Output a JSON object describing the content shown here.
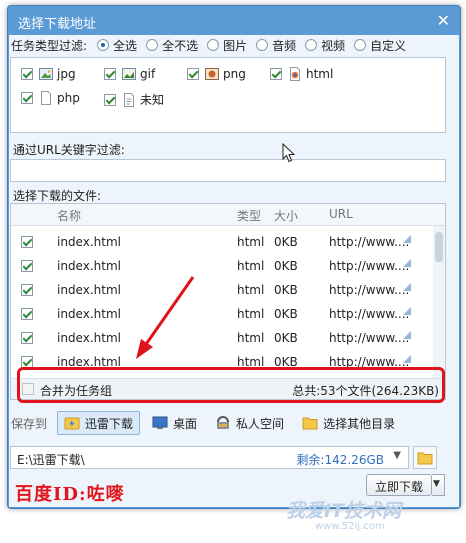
{
  "window": {
    "title": "选择下载地址",
    "close_glyph": "✕"
  },
  "type_filter": {
    "label": "任务类型过滤:",
    "options": [
      {
        "label": "全选",
        "selected": true
      },
      {
        "label": "全不选",
        "selected": false
      },
      {
        "label": "图片",
        "selected": false
      },
      {
        "label": "音频",
        "selected": false
      },
      {
        "label": "视频",
        "selected": false
      },
      {
        "label": "自定义",
        "selected": false
      }
    ],
    "types": [
      {
        "label": "jpg",
        "checked": true,
        "icon": "image-file-icon"
      },
      {
        "label": "gif",
        "checked": true,
        "icon": "gif-file-icon"
      },
      {
        "label": "png",
        "checked": true,
        "icon": "png-file-icon"
      },
      {
        "label": "html",
        "checked": true,
        "icon": "html-file-icon"
      },
      {
        "label": "php",
        "checked": true,
        "icon": "blank-file-icon"
      },
      {
        "label": "未知",
        "checked": true,
        "icon": "unknown-file-icon"
      }
    ]
  },
  "url_filter": {
    "label": "通过URL关键字过滤:",
    "value": ""
  },
  "file_list": {
    "label": "选择下载的文件:",
    "columns": {
      "name": "名称",
      "type": "类型",
      "size": "大小",
      "url": "URL"
    },
    "rows": [
      {
        "name": "index.html",
        "type": "html",
        "size": "0KB",
        "url": "http://www...."
      },
      {
        "name": "index.html",
        "type": "html",
        "size": "0KB",
        "url": "http://www...."
      },
      {
        "name": "index.html",
        "type": "html",
        "size": "0KB",
        "url": "http://www...."
      },
      {
        "name": "index.html",
        "type": "html",
        "size": "0KB",
        "url": "http://www...."
      },
      {
        "name": "index.html",
        "type": "html",
        "size": "0KB",
        "url": "http://www...."
      },
      {
        "name": "index.html",
        "type": "html",
        "size": "0KB",
        "url": "http://www...."
      }
    ],
    "merge_label": "合并为任务组",
    "total": "总共:53个文件(264.23KB)"
  },
  "save": {
    "label": "保存到",
    "locations": [
      {
        "label": "迅雷下载",
        "selected": true,
        "icon": "thunder-folder-icon"
      },
      {
        "label": "桌面",
        "selected": false,
        "icon": "desktop-icon"
      },
      {
        "label": "私人空间",
        "selected": false,
        "icon": "private-space-icon"
      },
      {
        "label": "选择其他目录",
        "selected": false,
        "icon": "folder-icon"
      }
    ],
    "path": "E:\\迅雷下载\\",
    "free_space": "剩余:142.26GB",
    "download_button": "立即下载"
  },
  "watermarks": {
    "baidu_id": "百度ID:咗嘜",
    "site_name": "我爱IT技术网",
    "site_url": "www.52ij.com"
  },
  "colors": {
    "title_bar": "#5b9bd5",
    "annotation_red": "#e0121b",
    "checkbox_green": "#2f8a2f"
  }
}
